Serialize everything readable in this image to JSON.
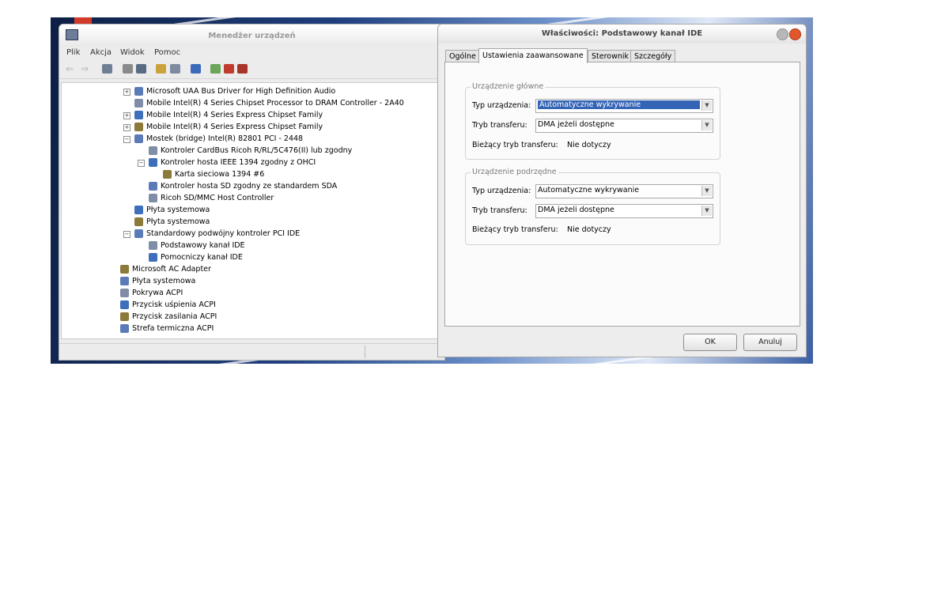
{
  "device_manager": {
    "title": "Menedżer urządzeń",
    "menu": [
      "Plik",
      "Akcja",
      "Widok",
      "Pomoc"
    ],
    "tree": [
      {
        "label": "Microsoft UAA Bus Driver for High Definition Audio",
        "depth": 1,
        "expander": "+"
      },
      {
        "label": "Mobile Intel(R) 4 Series Chipset Processor to DRAM Controller - 2A40",
        "depth": 1,
        "expander": ""
      },
      {
        "label": "Mobile Intel(R) 4 Series Express Chipset Family",
        "depth": 1,
        "expander": "+"
      },
      {
        "label": "Mobile Intel(R) 4 Series Express Chipset Family",
        "depth": 1,
        "expander": "+"
      },
      {
        "label": "Mostek (bridge) Intel(R) 82801 PCI - 2448",
        "depth": 1,
        "expander": "−"
      },
      {
        "label": "Kontroler CardBus Ricoh R/RL/5C476(II) lub zgodny",
        "depth": 2,
        "expander": ""
      },
      {
        "label": "Kontroler hosta IEEE 1394 zgodny z OHCI",
        "depth": 2,
        "expander": "−"
      },
      {
        "label": "Karta sieciowa 1394 #6",
        "depth": 3,
        "expander": ""
      },
      {
        "label": "Kontroler hosta SD zgodny ze standardem SDA",
        "depth": 2,
        "expander": ""
      },
      {
        "label": "Ricoh SD/MMC Host Controller",
        "depth": 2,
        "expander": ""
      },
      {
        "label": "Płyta systemowa",
        "depth": 1,
        "expander": ""
      },
      {
        "label": "Płyta systemowa",
        "depth": 1,
        "expander": ""
      },
      {
        "label": "Standardowy podwójny kontroler PCI IDE",
        "depth": 1,
        "expander": "−"
      },
      {
        "label": "Podstawowy kanał IDE",
        "depth": 2,
        "expander": ""
      },
      {
        "label": "Pomocniczy kanał IDE",
        "depth": 2,
        "expander": ""
      },
      {
        "label": "Microsoft AC Adapter",
        "depth": 0,
        "expander": ""
      },
      {
        "label": "Płyta systemowa",
        "depth": 0,
        "expander": ""
      },
      {
        "label": "Pokrywa ACPI",
        "depth": 0,
        "expander": ""
      },
      {
        "label": "Przycisk uśpienia ACPI",
        "depth": 0,
        "expander": ""
      },
      {
        "label": "Przycisk zasilania ACPI",
        "depth": 0,
        "expander": ""
      },
      {
        "label": "Strefa termiczna ACPI",
        "depth": 0,
        "expander": ""
      }
    ]
  },
  "properties": {
    "title": "Właściwości: Podstawowy kanał IDE",
    "tabs": [
      "Ogólne",
      "Ustawienia zaawansowane",
      "Sterownik",
      "Szczegóły"
    ],
    "active_tab": "Ustawienia zaawansowane",
    "primary": {
      "group_label": "Urządzenie główne",
      "device_type_label": "Typ urządzenia:",
      "device_type_value": "Automatyczne wykrywanie",
      "transfer_mode_label": "Tryb transferu:",
      "transfer_mode_value": "DMA jeżeli dostępne",
      "current_mode_label": "Bieżący tryb transferu:",
      "current_mode_value": "Nie dotyczy"
    },
    "secondary": {
      "group_label": "Urządzenie podrzędne",
      "device_type_label": "Typ urządzenia:",
      "device_type_value": "Automatyczne wykrywanie",
      "transfer_mode_label": "Tryb transferu:",
      "transfer_mode_value": "DMA jeżeli dostępne",
      "current_mode_label": "Bieżący tryb transferu:",
      "current_mode_value": "Nie dotyczy"
    },
    "ok_label": "OK",
    "cancel_label": "Anuluj"
  },
  "colors": {
    "selection": "#3464b5",
    "close_button": "#e2572b",
    "minimize_button": "#b8b8b8"
  }
}
